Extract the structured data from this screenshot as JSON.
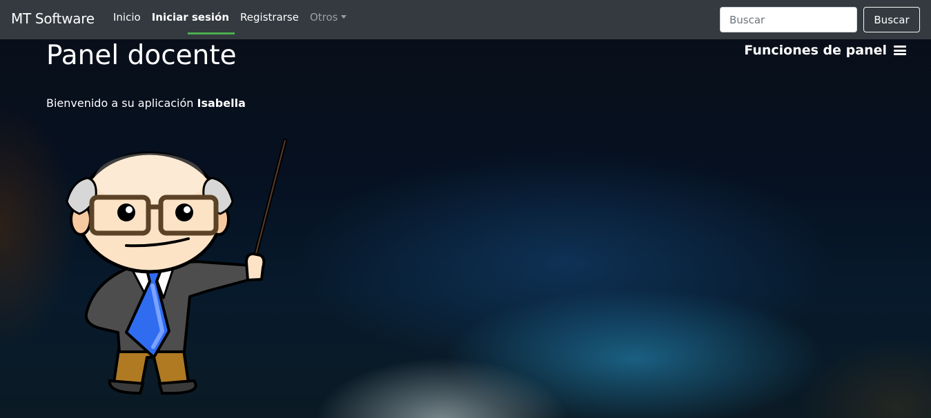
{
  "navbar": {
    "brand": "MT Software",
    "links": [
      {
        "label": "Inicio",
        "active": false
      },
      {
        "label": "Iniciar sesión",
        "active": true
      },
      {
        "label": "Registrarse",
        "active": false
      },
      {
        "label": "Otros",
        "active": false,
        "dropdown": true
      }
    ],
    "search": {
      "placeholder": "Buscar",
      "value": ""
    },
    "search_button": "Buscar",
    "active_indicator_color": "#4caf50"
  },
  "main": {
    "title": "Panel docente",
    "panel_functions": "Funciones de panel",
    "panel_functions_icon": "hamburger-menu-icon",
    "welcome_text": "Bienvenido a su aplicación",
    "user_name": "Isabella",
    "illustration": "teacher-with-pointer-illustration"
  }
}
